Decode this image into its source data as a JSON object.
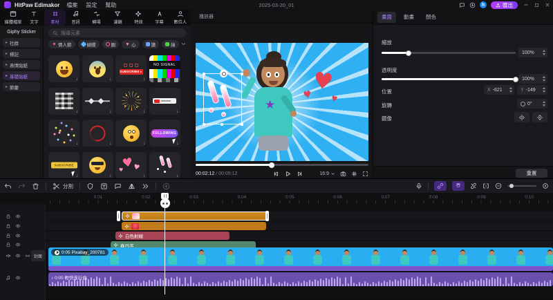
{
  "titlebar": {
    "app_name": "HitPaw Edimakor",
    "menu": [
      "檔案",
      "設定",
      "幫助"
    ],
    "project_title": "2025-03-20_01",
    "icons": [
      "feedback-icon",
      "update-icon"
    ],
    "account_initial": "h",
    "export_label": "匯出",
    "window_controls": [
      "minimize",
      "maximize",
      "close"
    ]
  },
  "toolbar": {
    "items": [
      {
        "label": "媒體檔案",
        "icon": "media-icon",
        "active": false
      },
      {
        "label": "文字",
        "icon": "text-icon",
        "active": false
      },
      {
        "label": "素材",
        "icon": "sticker-icon",
        "active": true
      },
      {
        "label": "音訊",
        "icon": "audio-icon",
        "active": false
      },
      {
        "label": "轉場",
        "icon": "transition-icon",
        "active": false
      },
      {
        "label": "濾鏡",
        "icon": "filter-icon",
        "active": false
      },
      {
        "label": "特效",
        "icon": "fx-icon",
        "active": false
      },
      {
        "label": "字幕",
        "icon": "subtitle-icon",
        "active": false
      },
      {
        "label": "數位人",
        "icon": "avatar-icon",
        "active": false
      }
    ]
  },
  "sidebar": {
    "header": "Giphy Sticker",
    "items": [
      {
        "label": "社群",
        "active": false
      },
      {
        "label": "標記",
        "active": false
      },
      {
        "label": "表情貼紙",
        "active": false
      },
      {
        "label": "基礎貼紙",
        "active": true
      },
      {
        "label": "節慶",
        "active": false
      }
    ]
  },
  "assets": {
    "search_placeholder": "搜尋元素",
    "chips": [
      {
        "label": "情人節",
        "icon": "heart-icon",
        "color": "#ff5f87"
      },
      {
        "label": "蝴蝶",
        "icon": "butterfly-icon",
        "color": "#57b8ff"
      },
      {
        "label": "圈",
        "icon": "ring-icon",
        "color": "#ff6b9d"
      },
      {
        "label": "心",
        "icon": "heart-icon",
        "color": "#ff8fb3"
      },
      {
        "label": "讚",
        "icon": "thumb-icon",
        "color": "#6aa9ff"
      },
      {
        "label": "綠",
        "icon": "green-icon",
        "color": "#4cd24c"
      }
    ],
    "tiles": [
      {
        "kind": "emoji",
        "variant": "laugh",
        "name": "laughing-emoji-sticker"
      },
      {
        "kind": "emoji",
        "variant": "scream",
        "name": "screaming-emoji-sticker"
      },
      {
        "kind": "subscribe",
        "label": "SUBSCRIBE",
        "name": "subscribe-banner-sticker"
      },
      {
        "kind": "nosignal",
        "label": "NO SIGNAL",
        "name": "no-signal-sticker"
      },
      {
        "kind": "glitch",
        "name": "glitch-sticker"
      },
      {
        "kind": "waveform",
        "name": "waveform-sticker"
      },
      {
        "kind": "fireworks",
        "name": "fireworks-sticker"
      },
      {
        "kind": "smallbar",
        "name": "subscribe-bar-sticker"
      },
      {
        "kind": "confetti",
        "name": "confetti-sticker"
      },
      {
        "kind": "circle",
        "name": "circle-scribble-sticker"
      },
      {
        "kind": "emoji",
        "variant": "flushed",
        "name": "flushed-emoji-sticker"
      },
      {
        "kind": "following",
        "label": "FOLLOWING",
        "cursor": true,
        "name": "following-banner-sticker"
      },
      {
        "kind": "suby",
        "label": "SUBSCRIBE",
        "cursor": true,
        "name": "yellow-subscribe-sticker"
      },
      {
        "kind": "emoji",
        "variant": "cool",
        "name": "cool-emoji-sticker"
      },
      {
        "kind": "hearts",
        "name": "hearts-sticker"
      },
      {
        "kind": "exclaim",
        "name": "exclamation-sticker"
      }
    ]
  },
  "player": {
    "panel_title": "播放器",
    "time_current": "00:02:12",
    "time_separator": "/",
    "time_total": "00:05:12",
    "progress_pct": 44,
    "ratio_label": "16:9"
  },
  "inspector": {
    "tabs": [
      {
        "label": "畫面",
        "active": true
      },
      {
        "label": "動畫",
        "active": false
      },
      {
        "label": "顏色",
        "active": false
      }
    ],
    "scale": {
      "label": "縮放",
      "value": "100%",
      "pct": 20
    },
    "opacity": {
      "label": "透明度",
      "value": "100%",
      "pct": 100
    },
    "position": {
      "label": "位置",
      "x_prefix": "X",
      "x_value": "-621",
      "y_prefix": "Y",
      "y_value": "-149"
    },
    "rotation": {
      "label": "旋轉",
      "value": "0°"
    },
    "mirror": {
      "label": "鏡像"
    },
    "reset_label": "重置"
  },
  "timeline": {
    "toolbar": {
      "left_icons": [
        "undo",
        "redo",
        "trash",
        "sep",
        "scissors",
        "sep",
        "crop",
        "freeze-frame",
        "speech-bubble",
        "audio-split",
        "speed",
        "sep",
        "record"
      ],
      "split_label": "分割",
      "right_icons": [
        "mic",
        "sep",
        "link",
        "magnet",
        "unlink",
        "fit",
        "zoom-out",
        "slider",
        "locate"
      ]
    },
    "ruler_labels": [
      "0:01",
      "0:02",
      "0:03",
      "0:04",
      "0:05",
      "0:06",
      "0:07",
      "0:08",
      "0:09",
      "0:10"
    ],
    "cover_label": "封面",
    "track_headers": [
      {
        "icons": [
          "lock",
          "eye"
        ]
      },
      {
        "icons": [
          "lock",
          "eye"
        ]
      },
      {
        "icons": [
          "lock",
          "eye"
        ]
      },
      {
        "icons": [
          "lock",
          "eye"
        ]
      },
      {
        "icons": [
          "mute",
          "eye",
          "chain"
        ]
      },
      {
        "icons": [
          "note",
          "eye"
        ]
      }
    ],
    "clips": {
      "sticker1": {
        "selected": true
      },
      "sticker2": {},
      "effect1": {
        "label": "白色射線"
      },
      "effect2": {
        "label": "春日序"
      },
      "video": {
        "label": "0:05 Pixabay_200781"
      },
      "audio": {
        "label": "0:05 輕快進行曲"
      }
    }
  }
}
